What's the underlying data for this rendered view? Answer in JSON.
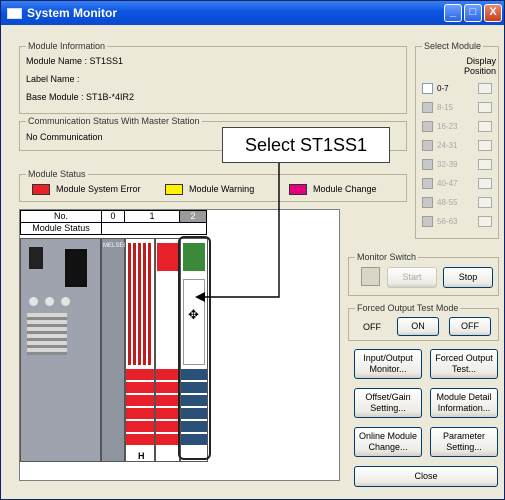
{
  "window": {
    "title": "System Monitor",
    "minimize": "_",
    "maximize": "□",
    "close": "X"
  },
  "module_info": {
    "group_label": "Module Information",
    "module_name": "Module Name :  ST1SS1",
    "label_name": "Label Name   :",
    "base_module": "Base Module  :  ST1B-*4IR2"
  },
  "comm_status": {
    "group_label": "Communication Status With Master Station",
    "value": "No Communication"
  },
  "module_status": {
    "group_label": "Module Status",
    "items": [
      {
        "label": "Module System Error",
        "color": "#e8202a"
      },
      {
        "label": "Module Warning",
        "color": "#fff200"
      },
      {
        "label": "Module Change",
        "color": "#e4007f"
      }
    ]
  },
  "select_module": {
    "group_label": "Select Module",
    "display_position": "Display Position",
    "ranges": [
      "0-7",
      "8-15",
      "16-23",
      "24-31",
      "32-39",
      "40-47",
      "48-55",
      "56-63"
    ]
  },
  "callout": "Select ST1SS1",
  "slot_table": {
    "header_no": "No.",
    "header_status": "Module Status",
    "slots": [
      "0",
      "1",
      "2"
    ],
    "plc_label": "MELSEC",
    "h_label": "H"
  },
  "monitor_switch": {
    "group_label": "Monitor Switch",
    "start": "Start",
    "stop": "Stop"
  },
  "forced_output": {
    "group_label": "Forced Output Test Mode",
    "state": "OFF",
    "on": "ON",
    "off": "OFF"
  },
  "buttons": {
    "io_monitor": "Input/Output Monitor...",
    "forced_output_test": "Forced Output Test...",
    "offset_gain": "Offset/Gain Setting...",
    "module_detail": "Module Detail Information...",
    "online_change": "Online Module Change...",
    "parameter": "Parameter Setting...",
    "close": "Close"
  },
  "colors": {
    "title_bar": "#0b54e0",
    "red_module": "#e8202a",
    "green_module": "#3a8a3a",
    "blue_terminal": "#2a4f78"
  }
}
